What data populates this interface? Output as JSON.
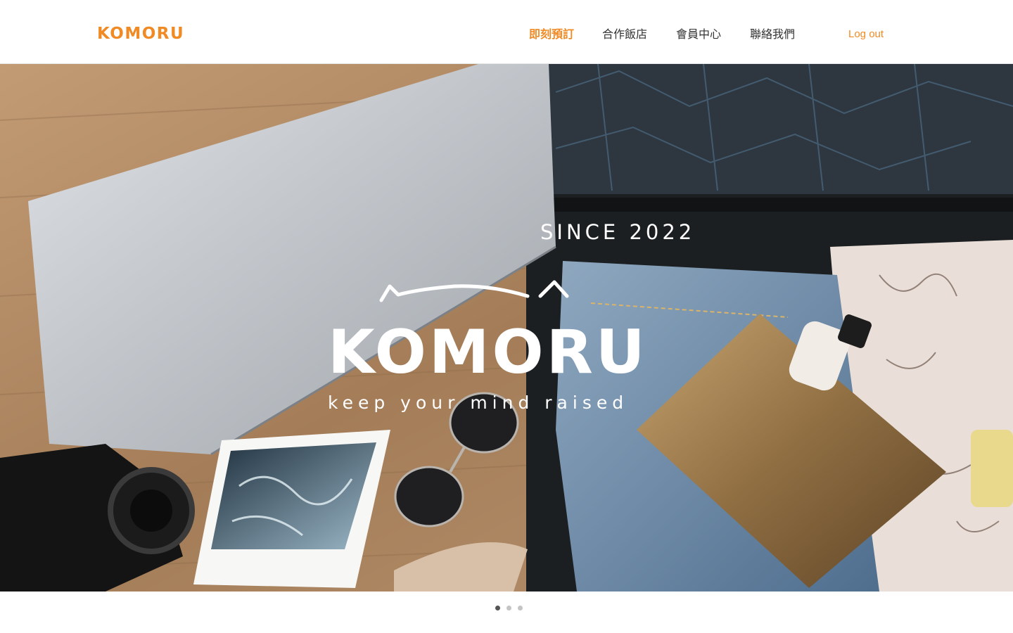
{
  "brand": "KOMORU",
  "nav": {
    "items": [
      {
        "label": "即刻預訂",
        "active": true
      },
      {
        "label": "合作飯店",
        "active": false
      },
      {
        "label": "會員中心",
        "active": false
      },
      {
        "label": "聯絡我們",
        "active": false
      }
    ],
    "logout": "Log out"
  },
  "hero": {
    "since": "SINCE 2022",
    "logo": "KOMORU",
    "slogan": "keep your mind raised"
  },
  "carousel": {
    "slides": 3,
    "active_index": 0
  },
  "colors": {
    "accent": "#f08a24",
    "nav_text": "#333333",
    "hero_text": "#ffffff"
  }
}
